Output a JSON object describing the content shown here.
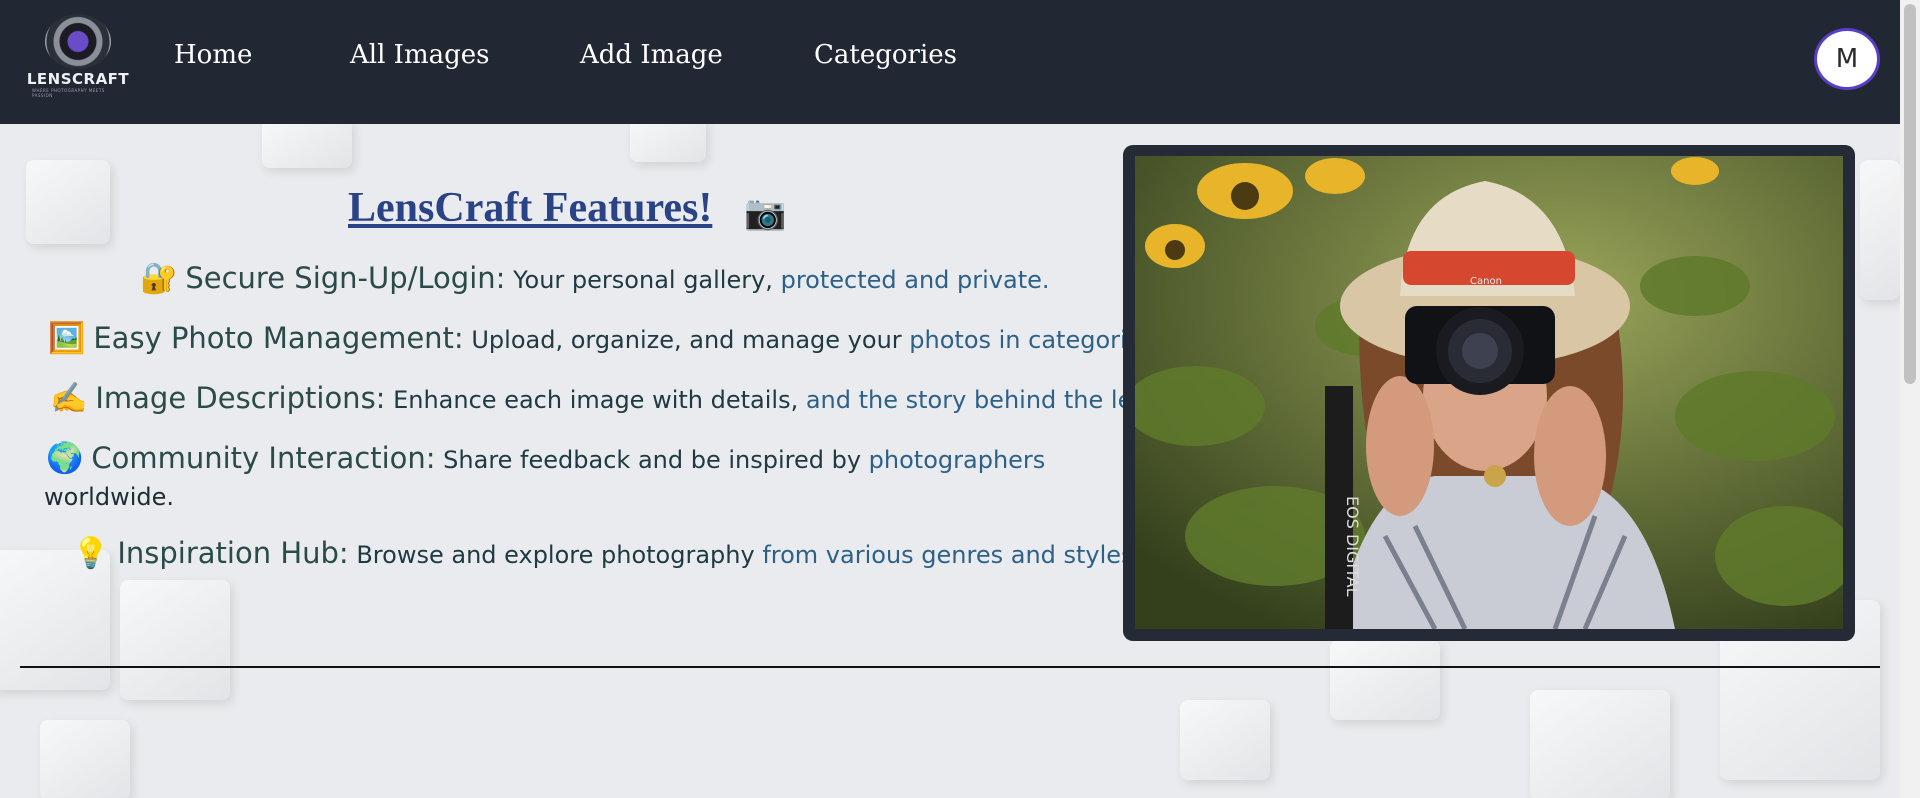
{
  "nav": {
    "logo_text": "LENSCRAFT",
    "logo_subtext": "WHERE PHOTOGRAPHY MEETS PASSION",
    "links": [
      "Home",
      "All Images",
      "Add Image",
      "Categories"
    ],
    "avatar_initial": "M"
  },
  "features": {
    "title": "LensCraft Features!",
    "title_emoji": "📷",
    "items": [
      {
        "emoji": "🔐",
        "title": "Secure Sign-Up/Login:",
        "desc_a": "Your personal gallery, ",
        "desc_b": "protected and private."
      },
      {
        "emoji": "🖼️",
        "title": "Easy Photo Management:",
        "desc_a": "Upload, organize, and manage your ",
        "desc_b": "photos in categories."
      },
      {
        "emoji": "✍️",
        "title": "Image Descriptions:",
        "desc_a": "Enhance each image with details, ",
        "desc_b": "and the story behind the lens."
      },
      {
        "emoji": "🌍",
        "title": "Community Interaction:",
        "desc_a": "Share feedback and be inspired by ",
        "desc_b": "photographers",
        "wrap": "worldwide."
      },
      {
        "emoji": "💡",
        "title": "Inspiration Hub:",
        "desc_a": "Browse and explore photography ",
        "desc_b": "from various genres and styles."
      }
    ]
  },
  "photo": {
    "camera_brand": "Canon",
    "strap_text": "EOS DIGITAL"
  },
  "colors": {
    "navbar": "#222833",
    "title": "#2a4386",
    "avatar_border": "#5b3ec8"
  }
}
